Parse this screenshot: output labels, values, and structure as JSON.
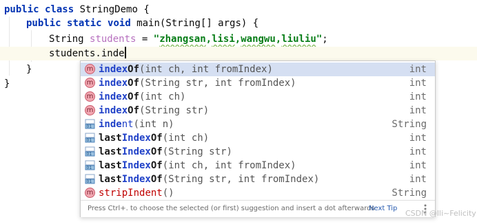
{
  "editor": {
    "lines": [
      {
        "parts": [
          "public",
          " ",
          "class",
          " StringDemo {"
        ]
      },
      {
        "parts": [
          "public",
          " ",
          "static",
          " ",
          "void",
          " main(String[] args) {"
        ]
      },
      {
        "parts": [
          "String ",
          "students",
          " = ",
          "\"",
          "zhangsan",
          ",",
          "lisi",
          ",",
          "wangwu",
          ",",
          "liuliu",
          "\"",
          ";"
        ]
      },
      {
        "parts": [
          "students.inde"
        ]
      },
      {
        "parts": [
          "}"
        ]
      },
      {
        "parts": [
          "}"
        ]
      }
    ]
  },
  "completion": {
    "items": [
      {
        "icon": "method-icon",
        "match": "index",
        "rest": "Of(int ch, int fromIndex)",
        "ret": "int",
        "selected": true
      },
      {
        "icon": "method-icon",
        "match": "index",
        "rest": "Of(String str, int fromIndex)",
        "ret": "int"
      },
      {
        "icon": "method-icon",
        "match": "index",
        "rest": "Of(int ch)",
        "ret": "int"
      },
      {
        "icon": "method-icon",
        "match": "index",
        "rest": "Of(String str)",
        "ret": "int"
      },
      {
        "icon": "field-method-icon",
        "match": "inde",
        "rest": "nt(int n)",
        "ret": "String"
      },
      {
        "icon": "field-method-icon",
        "match_pre": "last",
        "match": "Index",
        "rest": "Of(int ch)",
        "ret": "int"
      },
      {
        "icon": "field-method-icon",
        "match_pre": "last",
        "match": "Index",
        "rest": "Of(String str)",
        "ret": "int"
      },
      {
        "icon": "field-method-icon",
        "match_pre": "last",
        "match": "Index",
        "rest": "Of(int ch, int fromIndex)",
        "ret": "int"
      },
      {
        "icon": "field-method-icon",
        "match_pre": "last",
        "match": "Index",
        "rest": "Of(String str, int fromIndex)",
        "ret": "int"
      },
      {
        "icon": "method-icon",
        "match_pre": "strip",
        "match": "Indent",
        "rest": "()",
        "ret": "String"
      }
    ],
    "footer_hint": "Press Ctrl+. to choose the selected (or first) suggestion and insert a dot afterwards",
    "next_tip": "Next Tip"
  },
  "watermark": "CSDN @lli~Felicity",
  "colors": {
    "keyword": "#0033b3",
    "string": "#067d17",
    "selection": "#d5dff2",
    "link": "#2a5db0"
  }
}
